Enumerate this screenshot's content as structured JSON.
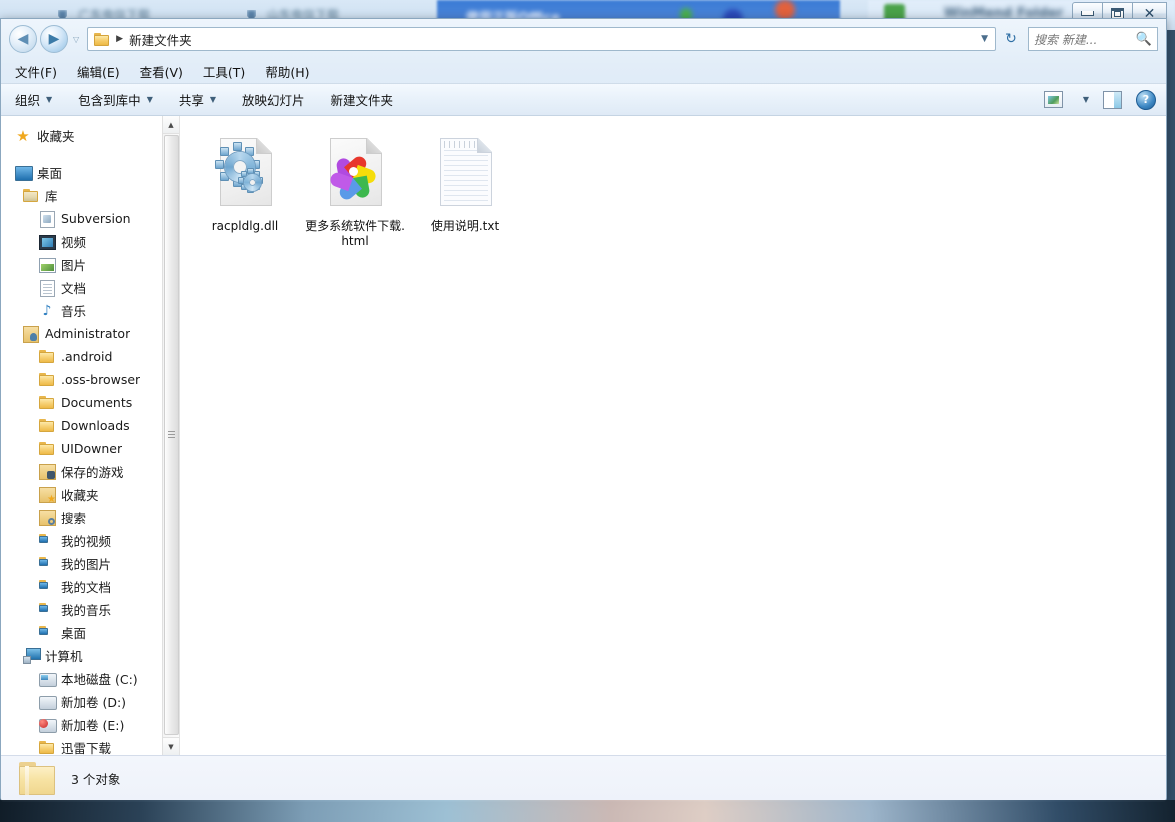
{
  "background": {
    "tabs": [
      {
        "label": "广东电信下载"
      },
      {
        "label": "山东电信下载"
      }
    ],
    "blue_panel_text": "使用正版Office",
    "right_panel_text": "WinMend Folder"
  },
  "window": {
    "controls": {
      "minimize": "minimize-button",
      "maximize": "maximize-button",
      "close": "close-button"
    },
    "address": {
      "back_label": "◀",
      "forward_label": "▶",
      "history_caret": "▽",
      "crumb": "新建文件夹",
      "crumb_arrow": "▶",
      "dropdown_caret": "▼",
      "refresh_label": "↻"
    },
    "search": {
      "placeholder": "搜索 新建...",
      "icon": "search-icon"
    },
    "menu": [
      {
        "label": "文件(F)"
      },
      {
        "label": "编辑(E)"
      },
      {
        "label": "查看(V)"
      },
      {
        "label": "工具(T)"
      },
      {
        "label": "帮助(H)"
      }
    ],
    "toolbar": {
      "items": [
        {
          "label": "组织",
          "caret": "▼"
        },
        {
          "label": "包含到库中",
          "caret": "▼"
        },
        {
          "label": "共享",
          "caret": "▼"
        },
        {
          "label": "放映幻灯片",
          "caret": ""
        },
        {
          "label": "新建文件夹",
          "caret": ""
        }
      ],
      "view_caret": "▼",
      "help_label": "?"
    }
  },
  "sidebar": {
    "items": [
      {
        "label": "收藏夹",
        "icon": "star-icon",
        "level": 0,
        "gap_after": true
      },
      {
        "label": "桌面",
        "icon": "monitor-icon",
        "level": 0
      },
      {
        "label": "库",
        "icon": "library-folder-icon",
        "level": 1
      },
      {
        "label": "Subversion",
        "icon": "subversion-icon",
        "level": 2
      },
      {
        "label": "视频",
        "icon": "video-icon",
        "level": 2
      },
      {
        "label": "图片",
        "icon": "picture-icon",
        "level": 2
      },
      {
        "label": "文档",
        "icon": "document-icon",
        "level": 2
      },
      {
        "label": "音乐",
        "icon": "music-icon",
        "level": 2
      },
      {
        "label": "Administrator",
        "icon": "user-folder-icon",
        "level": 1
      },
      {
        "label": ".android",
        "icon": "folder-icon",
        "level": 2
      },
      {
        "label": ".oss-browser",
        "icon": "folder-icon",
        "level": 2
      },
      {
        "label": "Documents",
        "icon": "folder-icon",
        "level": 2
      },
      {
        "label": "Downloads",
        "icon": "folder-icon",
        "level": 2
      },
      {
        "label": "UIDowner",
        "icon": "folder-icon",
        "level": 2
      },
      {
        "label": "保存的游戏",
        "icon": "saved-games-icon",
        "level": 2
      },
      {
        "label": "收藏夹",
        "icon": "favorites-folder-icon",
        "level": 2
      },
      {
        "label": "搜索",
        "icon": "search-folder-icon",
        "level": 2
      },
      {
        "label": "我的视频",
        "icon": "my-videos-icon",
        "level": 2
      },
      {
        "label": "我的图片",
        "icon": "my-pictures-icon",
        "level": 2
      },
      {
        "label": "我的文档",
        "icon": "my-documents-icon",
        "level": 2
      },
      {
        "label": "我的音乐",
        "icon": "my-music-icon",
        "level": 2
      },
      {
        "label": "桌面",
        "icon": "desktop-folder-icon",
        "level": 2
      },
      {
        "label": "计算机",
        "icon": "computer-icon",
        "level": 1
      },
      {
        "label": "本地磁盘 (C:)",
        "icon": "system-drive-icon",
        "level": 2
      },
      {
        "label": "新加卷 (D:)",
        "icon": "drive-icon",
        "level": 2
      },
      {
        "label": "新加卷 (E:)",
        "icon": "drive-full-icon",
        "level": 2
      },
      {
        "label": "迅雷下载",
        "icon": "folder-icon",
        "level": 2
      }
    ],
    "scroll_up": "▲",
    "scroll_down": "▼"
  },
  "files": [
    {
      "name": "racpldlg.dll",
      "icon": "dll-gear-icon"
    },
    {
      "name": "更多系统软件下载.html",
      "icon": "html-pinwheel-icon"
    },
    {
      "name": "使用说明.txt",
      "icon": "text-file-icon"
    }
  ],
  "pinwheel_colors": [
    "#b14ae0",
    "#e8372c",
    "#f5dd0a",
    "#3db84e",
    "#5a9ae8",
    "#c05ae8"
  ],
  "status": {
    "text": "3 个对象",
    "icon": "folder-icon"
  },
  "colors": {
    "accent": "#3a7bd5",
    "chrome_top": "#eef5fc",
    "chrome_bottom": "#dbe8f6",
    "folder_yellow": "#f0d78f"
  }
}
